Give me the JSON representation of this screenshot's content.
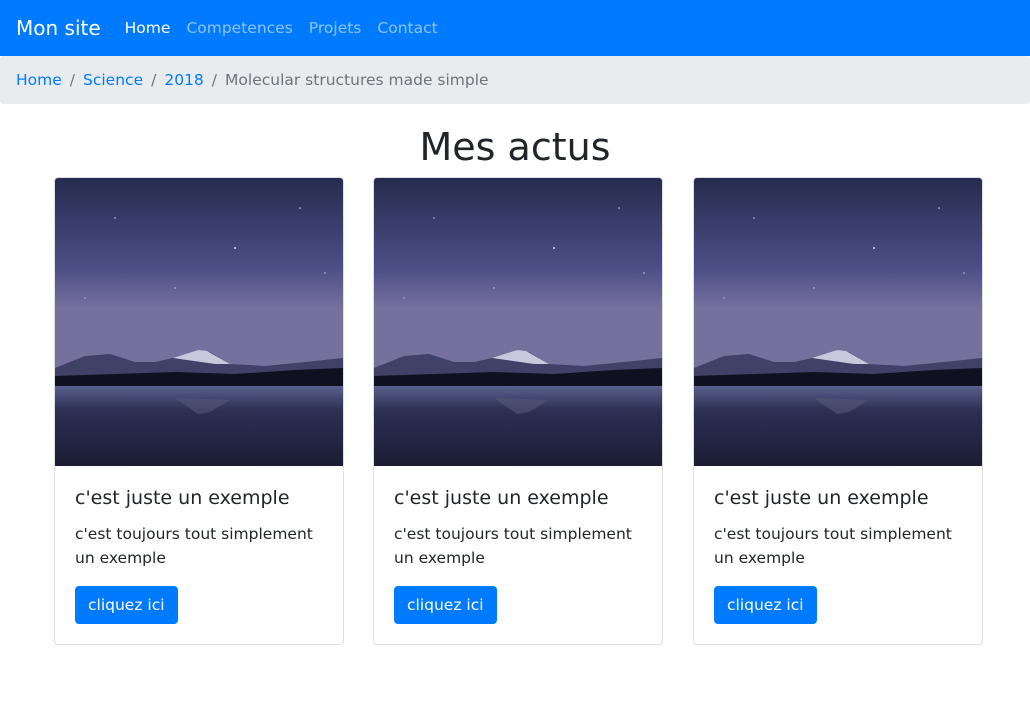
{
  "navbar": {
    "brand": "Mon site",
    "links": [
      {
        "label": "Home",
        "active": true
      },
      {
        "label": "Competences",
        "active": false
      },
      {
        "label": "Projets",
        "active": false
      },
      {
        "label": "Contact",
        "active": false
      }
    ]
  },
  "breadcrumb": {
    "items": [
      "Home",
      "Science",
      "2018"
    ],
    "separator": "/",
    "active": "Molecular structures made simple"
  },
  "main": {
    "title": "Mes actus",
    "cards": [
      {
        "image": "night-mountain-lake-image",
        "title": "c'est juste un exemple",
        "text": "c'est toujours tout simplement un exemple",
        "button": "cliquez ici"
      },
      {
        "image": "night-mountain-lake-image",
        "title": "c'est juste un exemple",
        "text": "c'est toujours tout simplement un exemple",
        "button": "cliquez ici"
      },
      {
        "image": "night-mountain-lake-image",
        "title": "c'est juste un exemple",
        "text": "c'est toujours tout simplement un exemple",
        "button": "cliquez ici"
      }
    ]
  },
  "colors": {
    "primary": "#007bff",
    "breadcrumb_bg": "#e9ecef",
    "muted": "#6c757d",
    "text": "#212529"
  }
}
